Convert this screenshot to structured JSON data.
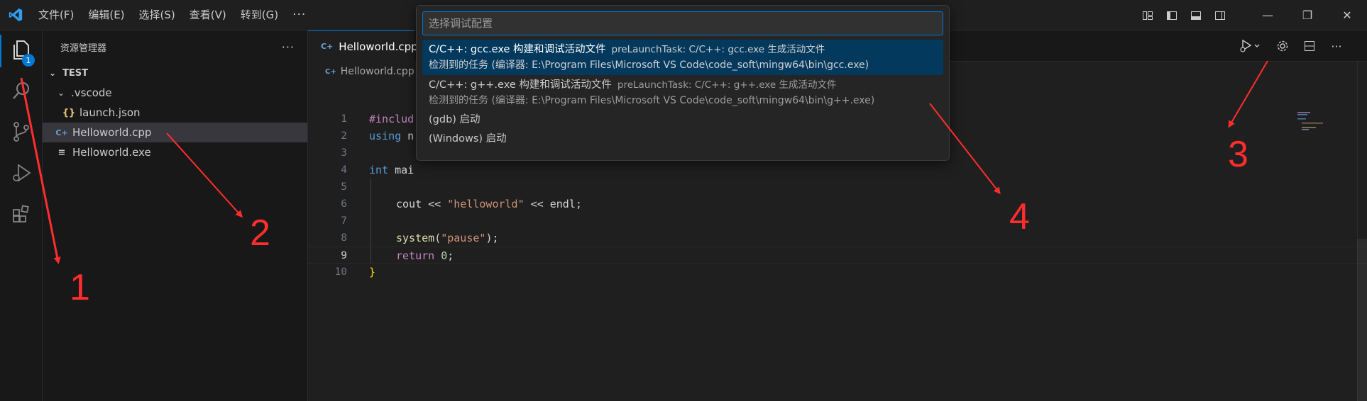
{
  "titlebar": {
    "logo_icon": "vscode-logo-icon",
    "menu": [
      "文件(F)",
      "编辑(E)",
      "选择(S)",
      "查看(V)",
      "转到(G)"
    ],
    "menu_more": "···",
    "layout_icons": [
      "customize-layout-icon",
      "toggle-primary-sidebar-icon",
      "toggle-panel-icon",
      "toggle-secondary-sidebar-icon"
    ],
    "window_buttons": {
      "minimize": "—",
      "restore": "❐",
      "close": "✕"
    }
  },
  "activitybar": {
    "items": [
      "explorer-icon",
      "search-icon",
      "source-control-icon",
      "run-and-debug-icon",
      "extensions-icon"
    ],
    "explorer_badge": "1"
  },
  "sidebar": {
    "title": "资源管理器",
    "more": "···",
    "section": "TEST",
    "tree": [
      {
        "label": ".vscode",
        "type": "folder",
        "icon": "chevron-down-icon"
      },
      {
        "label": "launch.json",
        "type": "json",
        "icon_text": "{}"
      },
      {
        "label": "Helloworld.cpp",
        "type": "cpp",
        "icon_text": "C+"
      },
      {
        "label": "Helloworld.exe",
        "type": "exe",
        "icon_text": "≡"
      }
    ]
  },
  "editor": {
    "tab": {
      "label": "Helloworld.cpp",
      "icon_text": "C+"
    },
    "breadcrumb": {
      "label": "Helloworld.cpp",
      "icon_text": "C+"
    },
    "actions": [
      "run-debug-icon",
      "chevron-down-icon",
      "gear-icon",
      "split-editor-icon",
      "more-actions-icon"
    ],
    "line_numbers": [
      "1",
      "2",
      "3",
      "4",
      "5",
      "6",
      "7",
      "8",
      "9",
      "10"
    ],
    "active_line": "9",
    "code": {
      "l1": "#includ",
      "l2_kw": "using",
      "l2_rest": " n",
      "l4_kw": "int",
      "l4_rest": " mai",
      "l6_a": "cout << ",
      "l6_str": "\"helloworld\"",
      "l6_b": " << endl;",
      "l8_fn": "system",
      "l8_p1": "(",
      "l8_str": "\"pause\"",
      "l8_p2": ");",
      "l9_kw": "return",
      "l9_num": "0",
      "l9_end": ";",
      "l10": "}"
    }
  },
  "quickpick": {
    "placeholder": "选择调试配置",
    "items": [
      {
        "label": "C/C++: gcc.exe 构建和调试活动文件",
        "description": "preLaunchTask: C/C++: gcc.exe 生成活动文件",
        "detail": "检测到的任务 (编译器: E:\\Program Files\\Microsoft VS Code\\code_soft\\mingw64\\bin\\gcc.exe)"
      },
      {
        "label": "C/C++: g++.exe 构建和调试活动文件",
        "description": "preLaunchTask: C/C++: g++.exe 生成活动文件",
        "detail": "检测到的任务 (编译器: E:\\Program Files\\Microsoft VS Code\\code_soft\\mingw64\\bin\\g++.exe)"
      },
      {
        "label": "(gdb) 启动"
      },
      {
        "label": "(Windows) 启动"
      }
    ]
  },
  "annotations": [
    "1",
    "2",
    "3",
    "4"
  ],
  "colors": {
    "accent": "#0078d4",
    "annotation": "#ff2d2d",
    "selected_item": "#04395e"
  }
}
